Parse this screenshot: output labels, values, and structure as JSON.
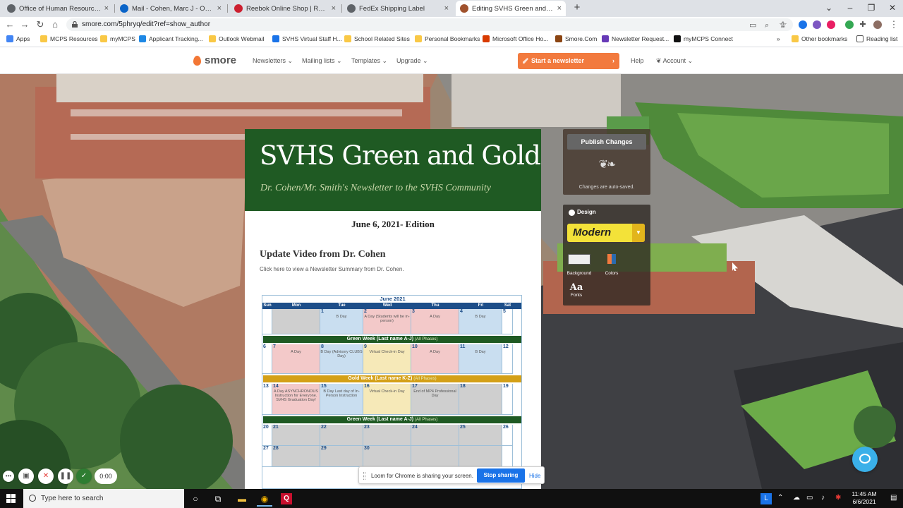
{
  "browser": {
    "tabs": [
      {
        "title": "Office of Human Resources - Mo",
        "icon_color": "#5f6368",
        "active": false
      },
      {
        "title": "Mail - Cohen, Marc J - Outlook",
        "icon_color": "#0a64c8",
        "active": false
      },
      {
        "title": "Reebok Online Shop | Reebok US",
        "icon_color": "#cc1f2f",
        "active": false
      },
      {
        "title": "FedEx Shipping Label",
        "icon_color": "#5f6368",
        "active": false
      },
      {
        "title": "Editing SVHS Green and Gold - S",
        "icon_color": "#a0522d",
        "active": true
      }
    ],
    "close_glyph": "×",
    "new_tab_glyph": "+",
    "url": "smore.com/5phryq/edit?ref=show_author",
    "bookmarks": [
      {
        "label": "Apps",
        "icon_color": "#4285f4"
      },
      {
        "label": "MCPS Resources",
        "icon_color": "#f9c846"
      },
      {
        "label": "myMCPS",
        "icon_color": "#f9c846"
      },
      {
        "label": "Applicant Tracking...",
        "icon_color": "#1e88e5"
      },
      {
        "label": "Outlook Webmail",
        "icon_color": "#f9c846"
      },
      {
        "label": "SVHS Virtual Staff H...",
        "icon_color": "#1a73e8"
      },
      {
        "label": "School Related Sites",
        "icon_color": "#f9c846"
      },
      {
        "label": "Personal Bookmarks",
        "icon_color": "#f9c846"
      },
      {
        "label": "Microsoft Office Ho...",
        "icon_color": "#d83b01"
      },
      {
        "label": "Smore.Com",
        "icon_color": "#8b4513"
      },
      {
        "label": "Newsletter Request...",
        "icon_color": "#673ab7"
      },
      {
        "label": "myMCPS Connect",
        "icon_color": "#111111"
      }
    ],
    "more_bookmarks": "»",
    "other_bookmarks": "Other bookmarks",
    "reading_list": "Reading list"
  },
  "smore": {
    "brand": "smore",
    "nav": [
      "Newsletters",
      "Mailing lists",
      "Templates",
      "Upgrade"
    ],
    "start_button": "Start a newsletter",
    "help": "Help",
    "account": "Account",
    "accent": "#f27a3e"
  },
  "newsletter": {
    "title": "SVHS Green and Gold",
    "subtitle": "Dr. Cohen/Mr. Smith's Newsletter to the SVHS Community",
    "edition": "June 6, 2021- Edition",
    "section_title": "Update Video from Dr. Cohen",
    "section_link": "Click here to view a Newsletter Summary from Dr. Cohen.",
    "header_color": "#1f5a23"
  },
  "calendar": {
    "month": "June 2021",
    "days": [
      "Sun",
      "Mon",
      "Tue",
      "Wed",
      "Thu",
      "Fri",
      "Sat"
    ],
    "weeks": [
      {
        "cells": [
          {
            "n": "",
            "t": "",
            "c": "#ffffff"
          },
          {
            "n": "",
            "t": "",
            "c": "#cfcfcf"
          },
          {
            "n": "1",
            "t": "B Day",
            "c": "#c9def0"
          },
          {
            "n": "2",
            "t": "A Day (Students will be in-person)",
            "c": "#f3c9c9"
          },
          {
            "n": "3",
            "t": "A Day",
            "c": "#f3c9c9"
          },
          {
            "n": "4",
            "t": "B Day",
            "c": "#c9def0"
          },
          {
            "n": "5",
            "t": "",
            "c": "#ffffff"
          }
        ],
        "band": {
          "label": "Green Week (Last name A-J)",
          "note": "(All Phases)",
          "color": "#1f5a23"
        }
      },
      {
        "cells": [
          {
            "n": "6",
            "t": "",
            "c": "#ffffff"
          },
          {
            "n": "7",
            "t": "A Day",
            "c": "#f3c9c9"
          },
          {
            "n": "8",
            "t": "B Day (Advisory CLUBS Day)",
            "c": "#c9def0"
          },
          {
            "n": "9",
            "t": "Virtual Check-in Day",
            "c": "#f6e9b8"
          },
          {
            "n": "10",
            "t": "A Day",
            "c": "#f3c9c9"
          },
          {
            "n": "11",
            "t": "B Day",
            "c": "#c9def0"
          },
          {
            "n": "12",
            "t": "",
            "c": "#ffffff"
          }
        ],
        "band": {
          "label": "Gold Week (Last name K-Z)",
          "note": "(All Phases)",
          "color": "#d4a017"
        }
      },
      {
        "cells": [
          {
            "n": "13",
            "t": "",
            "c": "#ffffff"
          },
          {
            "n": "14",
            "t": "A Day ASYNCHRONOUS Instruction for Everyone. SVHS Graduation Day!",
            "c": "#f3c9c9"
          },
          {
            "n": "15",
            "t": "B Day Last day of In-Person Instruction",
            "c": "#c9def0"
          },
          {
            "n": "16",
            "t": "Virtual Check-in Day",
            "c": "#f6e9b8"
          },
          {
            "n": "17",
            "t": "End of MP4 Professional Day",
            "c": "#cfcfcf"
          },
          {
            "n": "18",
            "t": "",
            "c": "#cfcfcf"
          },
          {
            "n": "19",
            "t": "",
            "c": "#ffffff"
          }
        ],
        "band": {
          "label": "Green Week (Last name A-J)",
          "note": "(All Phases)",
          "color": "#1f5a23"
        }
      },
      {
        "cells": [
          {
            "n": "20",
            "t": "",
            "c": "#ffffff"
          },
          {
            "n": "21",
            "t": "",
            "c": "#cfcfcf"
          },
          {
            "n": "22",
            "t": "",
            "c": "#cfcfcf"
          },
          {
            "n": "23",
            "t": "",
            "c": "#cfcfcf"
          },
          {
            "n": "24",
            "t": "",
            "c": "#cfcfcf"
          },
          {
            "n": "25",
            "t": "",
            "c": "#cfcfcf"
          },
          {
            "n": "26",
            "t": "",
            "c": "#ffffff"
          }
        ],
        "band": null
      },
      {
        "cells": [
          {
            "n": "27",
            "t": "",
            "c": "#ffffff"
          },
          {
            "n": "28",
            "t": "",
            "c": "#cfcfcf"
          },
          {
            "n": "29",
            "t": "",
            "c": "#cfcfcf"
          },
          {
            "n": "30",
            "t": "",
            "c": "#cfcfcf"
          },
          {
            "n": "",
            "t": "",
            "c": "#cfcfcf"
          },
          {
            "n": "",
            "t": "",
            "c": "#cfcfcf"
          },
          {
            "n": "",
            "t": "",
            "c": "#ffffff"
          }
        ],
        "band": null
      }
    ]
  },
  "editor": {
    "publish": "Publish Changes",
    "autosaved": "Changes are auto-saved.",
    "design": "Design",
    "theme": "Modern",
    "background": "Background",
    "colors": "Colors",
    "fonts_glyph": "Aa",
    "fonts": "Fonts",
    "theme_color": "#f3e239"
  },
  "loom": {
    "timer": "0:00",
    "message": "Loom for Chrome is sharing your screen.",
    "stop": "Stop sharing",
    "hide": "Hide"
  },
  "taskbar": {
    "search_placeholder": "Type here to search",
    "time": "11:45 AM",
    "date": "6/6/2021"
  }
}
